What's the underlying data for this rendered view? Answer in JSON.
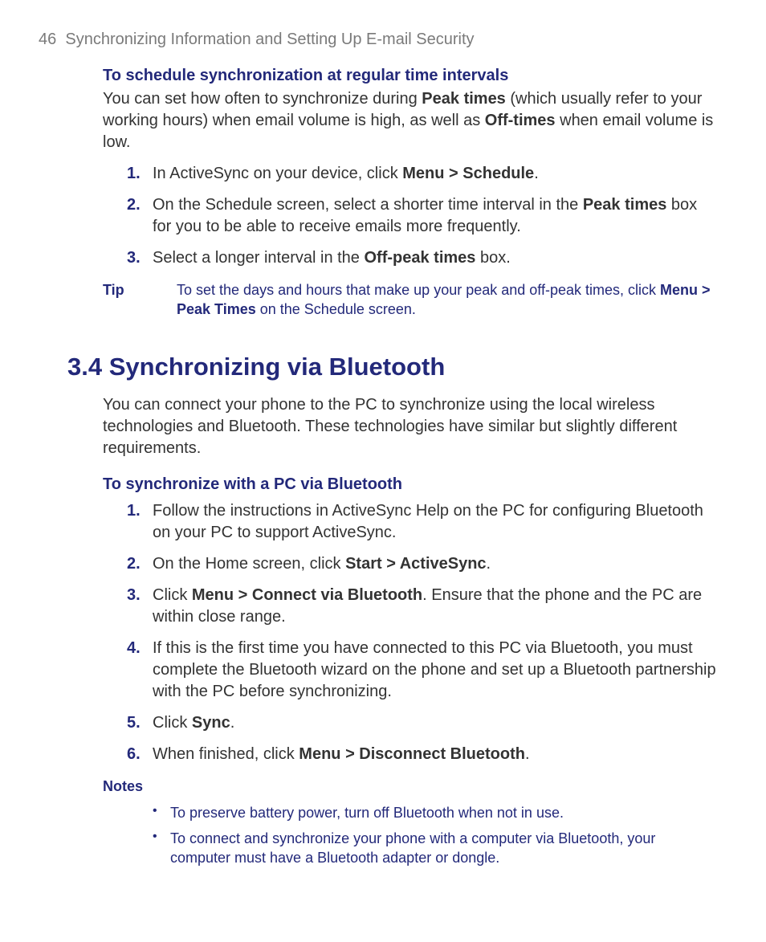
{
  "header": {
    "page_number": "46",
    "chapter_title": "Synchronizing Information and Setting Up E-mail Security"
  },
  "section_a": {
    "heading": "To schedule synchronization at regular time intervals",
    "intro_pre": "You can set how often to synchronize during ",
    "intro_b1": "Peak times",
    "intro_mid": " (which usually refer to your working hours) when email volume is high, as well as ",
    "intro_b2": "Off-times",
    "intro_post": " when email volume is low.",
    "steps": [
      {
        "num": "1.",
        "pre": "In ActiveSync on your device, click ",
        "b1": "Menu > Schedule",
        "post": "."
      },
      {
        "num": "2.",
        "pre": "On the Schedule screen, select a shorter time interval in the ",
        "b1": "Peak times",
        "post": " box for you to be able to receive emails more frequently."
      },
      {
        "num": "3.",
        "pre": "Select a longer interval in the ",
        "b1": "Off-peak times",
        "post": " box."
      }
    ],
    "tip_label": "Tip",
    "tip_pre": "To set the days and hours that make up your peak and off-peak times, click ",
    "tip_b1": "Menu > Peak Times",
    "tip_post": " on the Schedule screen."
  },
  "section_b": {
    "number": "3.4",
    "title": "Synchronizing via Bluetooth",
    "intro": "You can connect your phone to the PC to synchronize using the local wireless technologies and Bluetooth. These technologies have similar but slightly different requirements.",
    "sub_heading": "To synchronize with a PC via Bluetooth",
    "steps": [
      {
        "num": "1.",
        "text": "Follow the instructions in ActiveSync Help on the PC for configuring Bluetooth on your PC to support ActiveSync."
      },
      {
        "num": "2.",
        "pre": "On the Home screen, click ",
        "b1": "Start > ActiveSync",
        "post": "."
      },
      {
        "num": "3.",
        "pre": "Click ",
        "b1": "Menu > Connect via Bluetooth",
        "post": ". Ensure that the phone and the PC are within close range."
      },
      {
        "num": "4.",
        "text": "If this is the first time you have connected to this PC via Bluetooth, you must complete the Bluetooth wizard on the phone and set up a Bluetooth partnership with the PC before synchronizing."
      },
      {
        "num": "5.",
        "pre": "Click ",
        "b1": "Sync",
        "post": "."
      },
      {
        "num": "6.",
        "pre": "When finished, click ",
        "b1": "Menu > Disconnect Bluetooth",
        "post": "."
      }
    ],
    "notes_label": "Notes",
    "notes": [
      "To preserve battery power, turn off Bluetooth when not in use.",
      "To connect and synchronize your phone with a computer via Bluetooth, your computer must have a Bluetooth adapter or dongle."
    ]
  }
}
